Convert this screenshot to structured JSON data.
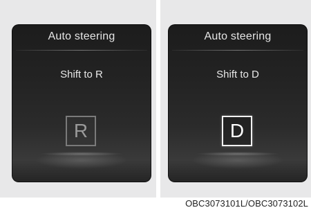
{
  "panels": [
    {
      "title": "Auto steering",
      "message": "Shift to R",
      "gear": "R",
      "gear_state": "dim"
    },
    {
      "title": "Auto steering",
      "message": "Shift to D",
      "gear": "D",
      "gear_state": "highlighted"
    }
  ],
  "caption": "OBC3073101L/OBC3073102L"
}
